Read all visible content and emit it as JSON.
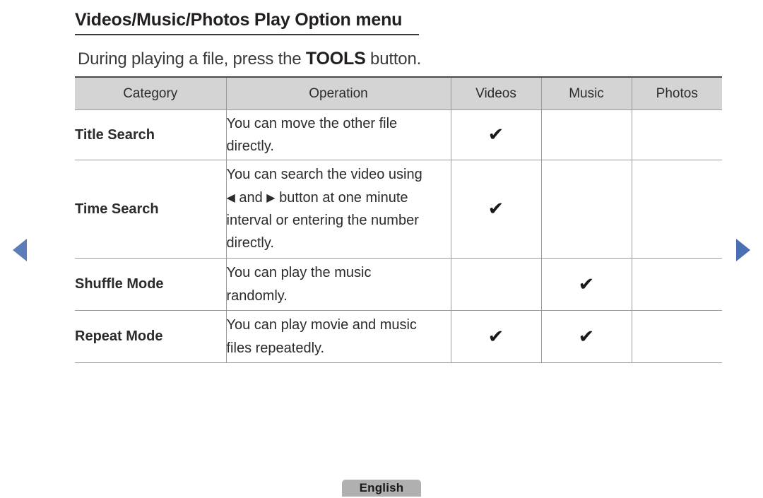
{
  "title": "Videos/Music/Photos Play Option menu",
  "subtitle": {
    "before": "During playing a file, press the ",
    "emphasis": "TOOLS",
    "after": " button."
  },
  "table": {
    "headers": [
      "Category",
      "Operation",
      "Videos",
      "Music",
      "Photos"
    ],
    "rows": [
      {
        "category": "Title Search",
        "operation_lines": [
          "You can move the other file",
          "directly."
        ],
        "videos": "✔",
        "music": "",
        "photos": ""
      },
      {
        "category": "Time Search",
        "operation_lines": [
          "You can search the video using",
          "◀ and ▶ button at one minute",
          "interval or entering the number",
          "directly."
        ],
        "videos": "✔",
        "music": "",
        "photos": ""
      },
      {
        "category": "Shuffle Mode",
        "operation_lines": [
          "You can play the music",
          "randomly."
        ],
        "videos": "",
        "music": "✔",
        "photos": ""
      },
      {
        "category": "Repeat Mode",
        "operation_lines": [
          "You can play movie and music",
          "files repeatedly."
        ],
        "videos": "✔",
        "music": "✔",
        "photos": ""
      }
    ]
  },
  "nav": {
    "previous_label": "◀",
    "next_label": "▶"
  },
  "footer": {
    "language": "English"
  },
  "colors": {
    "category_blue": "#5b7eb8",
    "nav_left_blue": "#5b7eb8",
    "nav_right_blue": "#4a6fb5",
    "header_gray": "#d4d4d4",
    "badge_gray": "#b0b0b0",
    "text": "#231f20"
  }
}
